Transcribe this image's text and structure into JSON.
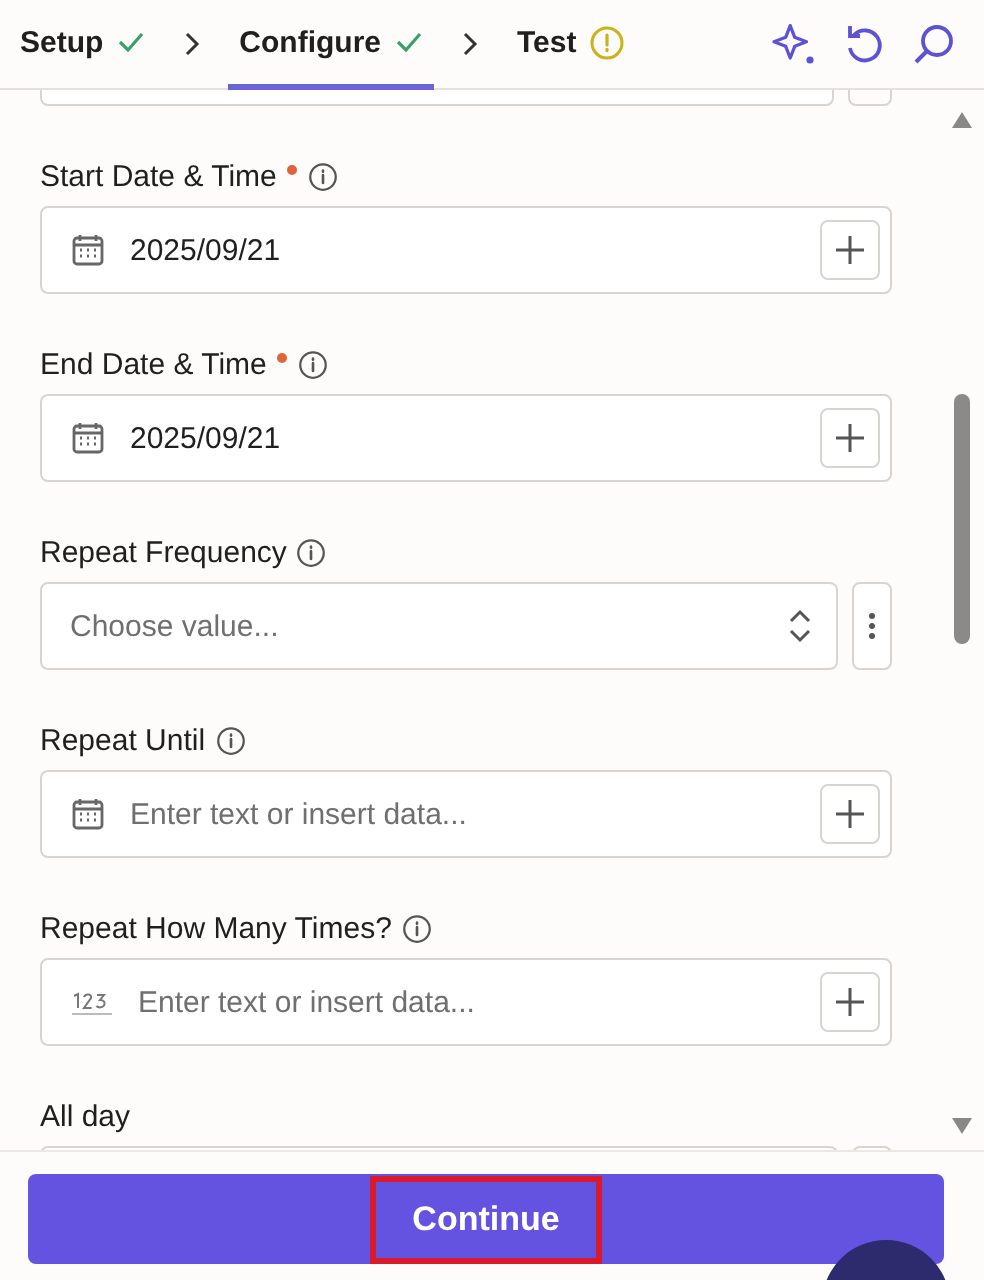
{
  "steps": [
    {
      "label": "Setup",
      "done": true,
      "warning": false,
      "selected": false
    },
    {
      "label": "Configure",
      "done": true,
      "warning": false,
      "selected": true
    },
    {
      "label": "Test",
      "done": false,
      "warning": true,
      "selected": false
    }
  ],
  "fields": [
    {
      "kind": "date",
      "label": "Start Date & Time",
      "required": true,
      "info": true,
      "value": "2025/09/21"
    },
    {
      "kind": "date",
      "label": "End Date & Time",
      "required": true,
      "info": true,
      "value": "2025/09/21"
    },
    {
      "kind": "select",
      "label": "Repeat Frequency",
      "required": false,
      "info": true,
      "placeholder": "Choose value..."
    },
    {
      "kind": "date",
      "label": "Repeat Until",
      "required": false,
      "info": true,
      "placeholder": "Enter text or insert data..."
    },
    {
      "kind": "number",
      "label": "Repeat How Many Times?",
      "required": false,
      "info": true,
      "placeholder": "Enter text or insert data..."
    },
    {
      "kind": "select",
      "label": "All day",
      "required": false,
      "info": false
    }
  ],
  "continue_button": {
    "label": "Continue",
    "highlighted": true
  }
}
